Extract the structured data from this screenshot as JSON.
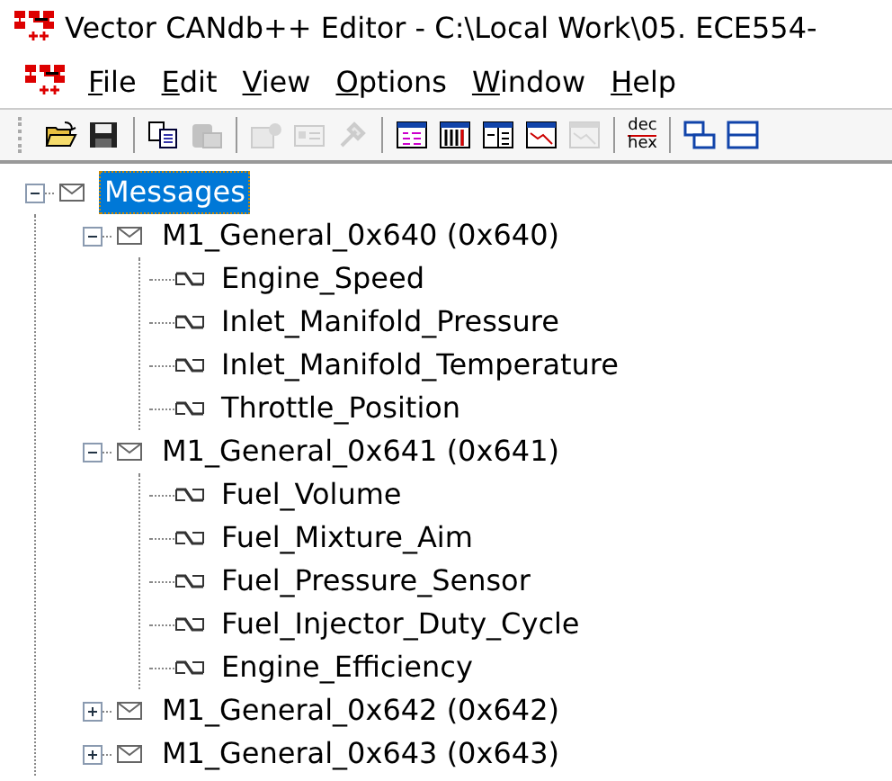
{
  "window": {
    "title": "Vector CANdb++ Editor - C:\\Local Work\\05. ECE554-"
  },
  "menu": [
    "File",
    "Edit",
    "View",
    "Options",
    "Window",
    "Help"
  ],
  "toolbar": [
    {
      "kind": "open",
      "disabled": false
    },
    {
      "kind": "save",
      "disabled": false
    },
    {
      "kind": "sep"
    },
    {
      "kind": "copy",
      "disabled": false
    },
    {
      "kind": "paste",
      "disabled": true
    },
    {
      "kind": "sep"
    },
    {
      "kind": "note",
      "disabled": true
    },
    {
      "kind": "card",
      "disabled": true
    },
    {
      "kind": "wrench",
      "disabled": true
    },
    {
      "kind": "sep"
    },
    {
      "kind": "list",
      "disabled": false
    },
    {
      "kind": "columns",
      "disabled": false
    },
    {
      "kind": "split",
      "disabled": false
    },
    {
      "kind": "graph",
      "disabled": false
    },
    {
      "kind": "graph",
      "disabled": true
    },
    {
      "kind": "sep"
    },
    {
      "kind": "dechex",
      "top": "dec",
      "bottom": "hex",
      "disabled": false
    },
    {
      "kind": "sep"
    },
    {
      "kind": "windows",
      "disabled": false
    },
    {
      "kind": "tile",
      "disabled": false
    }
  ],
  "tree": [
    {
      "kind": "folder",
      "label": "Messages",
      "selected": true,
      "expanded": true,
      "children": [
        {
          "kind": "message",
          "label": "M1_General_0x640 (0x640)",
          "selected": false,
          "expanded": true,
          "children": [
            {
              "kind": "signal",
              "label": "Engine_Speed",
              "selected": false
            },
            {
              "kind": "signal",
              "label": "Inlet_Manifold_Pressure",
              "selected": false
            },
            {
              "kind": "signal",
              "label": "Inlet_Manifold_Temperature",
              "selected": false
            },
            {
              "kind": "signal",
              "label": "Throttle_Position",
              "selected": false
            }
          ]
        },
        {
          "kind": "message",
          "label": "M1_General_0x641 (0x641)",
          "selected": false,
          "expanded": true,
          "children": [
            {
              "kind": "signal",
              "label": "Fuel_Volume",
              "selected": false
            },
            {
              "kind": "signal",
              "label": "Fuel_Mixture_Aim",
              "selected": false
            },
            {
              "kind": "signal",
              "label": "Fuel_Pressure_Sensor",
              "selected": false
            },
            {
              "kind": "signal",
              "label": "Fuel_Injector_Duty_Cycle",
              "selected": false
            },
            {
              "kind": "signal",
              "label": "Engine_Efficiency",
              "selected": false
            }
          ]
        },
        {
          "kind": "message",
          "label": "M1_General_0x642 (0x642)",
          "selected": false,
          "expanded": false
        },
        {
          "kind": "message",
          "label": "M1_General_0x643 (0x643)",
          "selected": false,
          "expanded": false
        }
      ]
    }
  ]
}
